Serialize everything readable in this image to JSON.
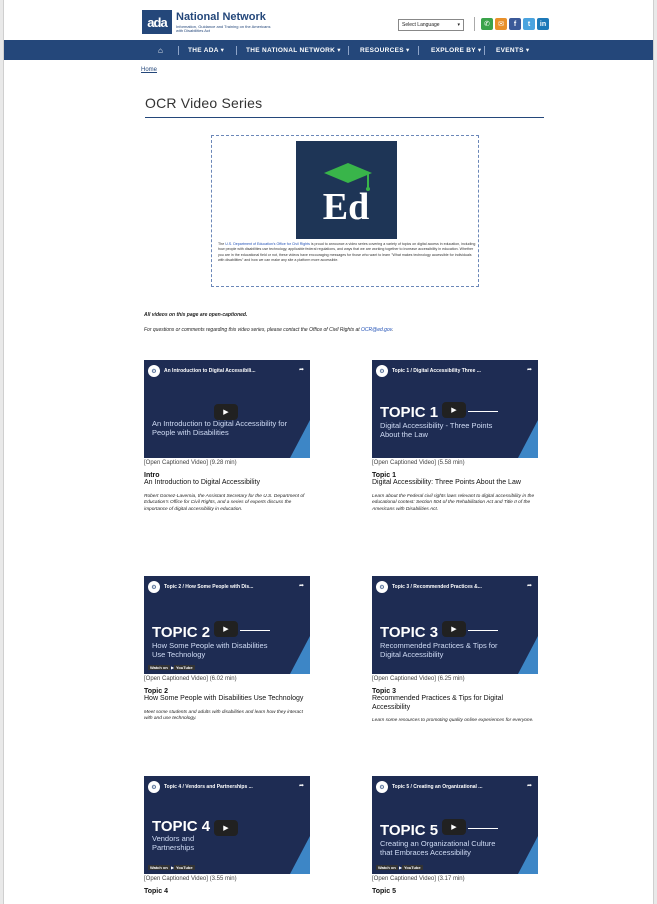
{
  "header": {
    "logo_mark": "ada",
    "logo_title": "National Network",
    "logo_sub": "Information, Guidance and Training on the Americans with Disabilities Act",
    "language": "Select Language"
  },
  "nav": {
    "home": "⌂",
    "items": [
      "THE ADA ▾",
      "THE NATIONAL NETWORK ▾",
      "RESOURCES ▾",
      "EXPLORE BY ▾",
      "EVENTS ▾"
    ]
  },
  "breadcrumb": "Home",
  "page_title": "OCR Video Series",
  "intro": {
    "prefix": "The ",
    "link1": "U.S. Department of Education's",
    "link2": "Office for Civil Rights",
    "body": " is proud to announce a video series covering a variety of topics on digital access in education, including how people with disabilities use technology, applicable federal regulations, and ways that we are working together to increase accessibility in education. Whether you are in the educational field or not, these videos have encouraging messages for those who want to learn \"What makes technology accessible for individuals with disabilities\" and how we can make any site a platform more accessible."
  },
  "notes": {
    "captioned": "All videos on this page are open-captioned.",
    "contact_prefix": "For questions or comments regarding this video series, please contact the Office of Civil Rights at ",
    "contact_link": "OCR@ed.gov",
    "contact_suffix": "."
  },
  "videos": [
    {
      "yt_title": "An Introduction to Digital Accessibili...",
      "big": "",
      "sub": "An Introduction to Digital Accessibility for People with Disabilities",
      "meta": "[Open Captioned Video] (9.28 min)",
      "topic": "Intro",
      "title": "An Introduction to Digital Accessibility",
      "desc": "Robert Gomez-Lavernia, the Assistant Secretary for the U.S. Department of Education's Office for Civil Rights, and a series of experts discuss the importance of digital accessibility in education."
    },
    {
      "yt_title": "Topic 1 / Digital Accessibility Three ...",
      "big": "TOPIC 1",
      "sub": "Digital Accessibility - Three Points About the Law",
      "meta": "[Open Captioned Video] (5.58 min)",
      "topic": "Topic 1",
      "title": "Digital Accessibility: Three Points About the Law",
      "desc": "Learn about the Federal civil rights laws relevant to digital accessibility in the educational context: Section 504 of the Rehabilitation Act and Title II of the Americans with Disabilities Act."
    },
    {
      "yt_title": "Topic 2 / How Some People with Dis...",
      "big": "TOPIC 2",
      "sub": "How Some People with Disabilities Use Technology",
      "meta": "[Open Captioned Video] (6.02 min)",
      "topic": "Topic 2",
      "title": "How Some People with Disabilities Use Technology",
      "desc": "Meet some students and adults with disabilities and learn how they interact with and use technology."
    },
    {
      "yt_title": "Topic 3 / Recommended Practices &...",
      "big": "TOPIC 3",
      "sub": "Recommended Practices & Tips for Digital Accessibility",
      "meta": "[Open Captioned Video] (6.25 min)",
      "topic": "Topic 3",
      "title": "Recommended Practices & Tips for Digital Accessibility",
      "desc": "Learn some resources to promoting quality online experiences for everyone."
    },
    {
      "yt_title": "Topic 4 / Vendors and Partnerships ...",
      "big": "TOPIC 4",
      "sub": "Vendors and Partnerships",
      "meta": "[Open Captioned Video] (3.55 min)",
      "topic": "Topic 4",
      "title": "",
      "desc": ""
    },
    {
      "yt_title": "Topic 5 / Creating an Organizational ...",
      "big": "TOPIC 5",
      "sub": "Creating an Organizational Culture that Embraces Accessibility",
      "meta": "[Open Captioned Video] (3.17 min)",
      "topic": "Topic 5",
      "title": "",
      "desc": ""
    }
  ],
  "watch_on": "Watch on",
  "youtube": "YouTube",
  "share": "Share",
  "colors": {
    "brand": "#24477a",
    "thumb_bg": "#1e2c53",
    "thumb_accent": "#3d86c6",
    "link": "#1f4fb5"
  }
}
